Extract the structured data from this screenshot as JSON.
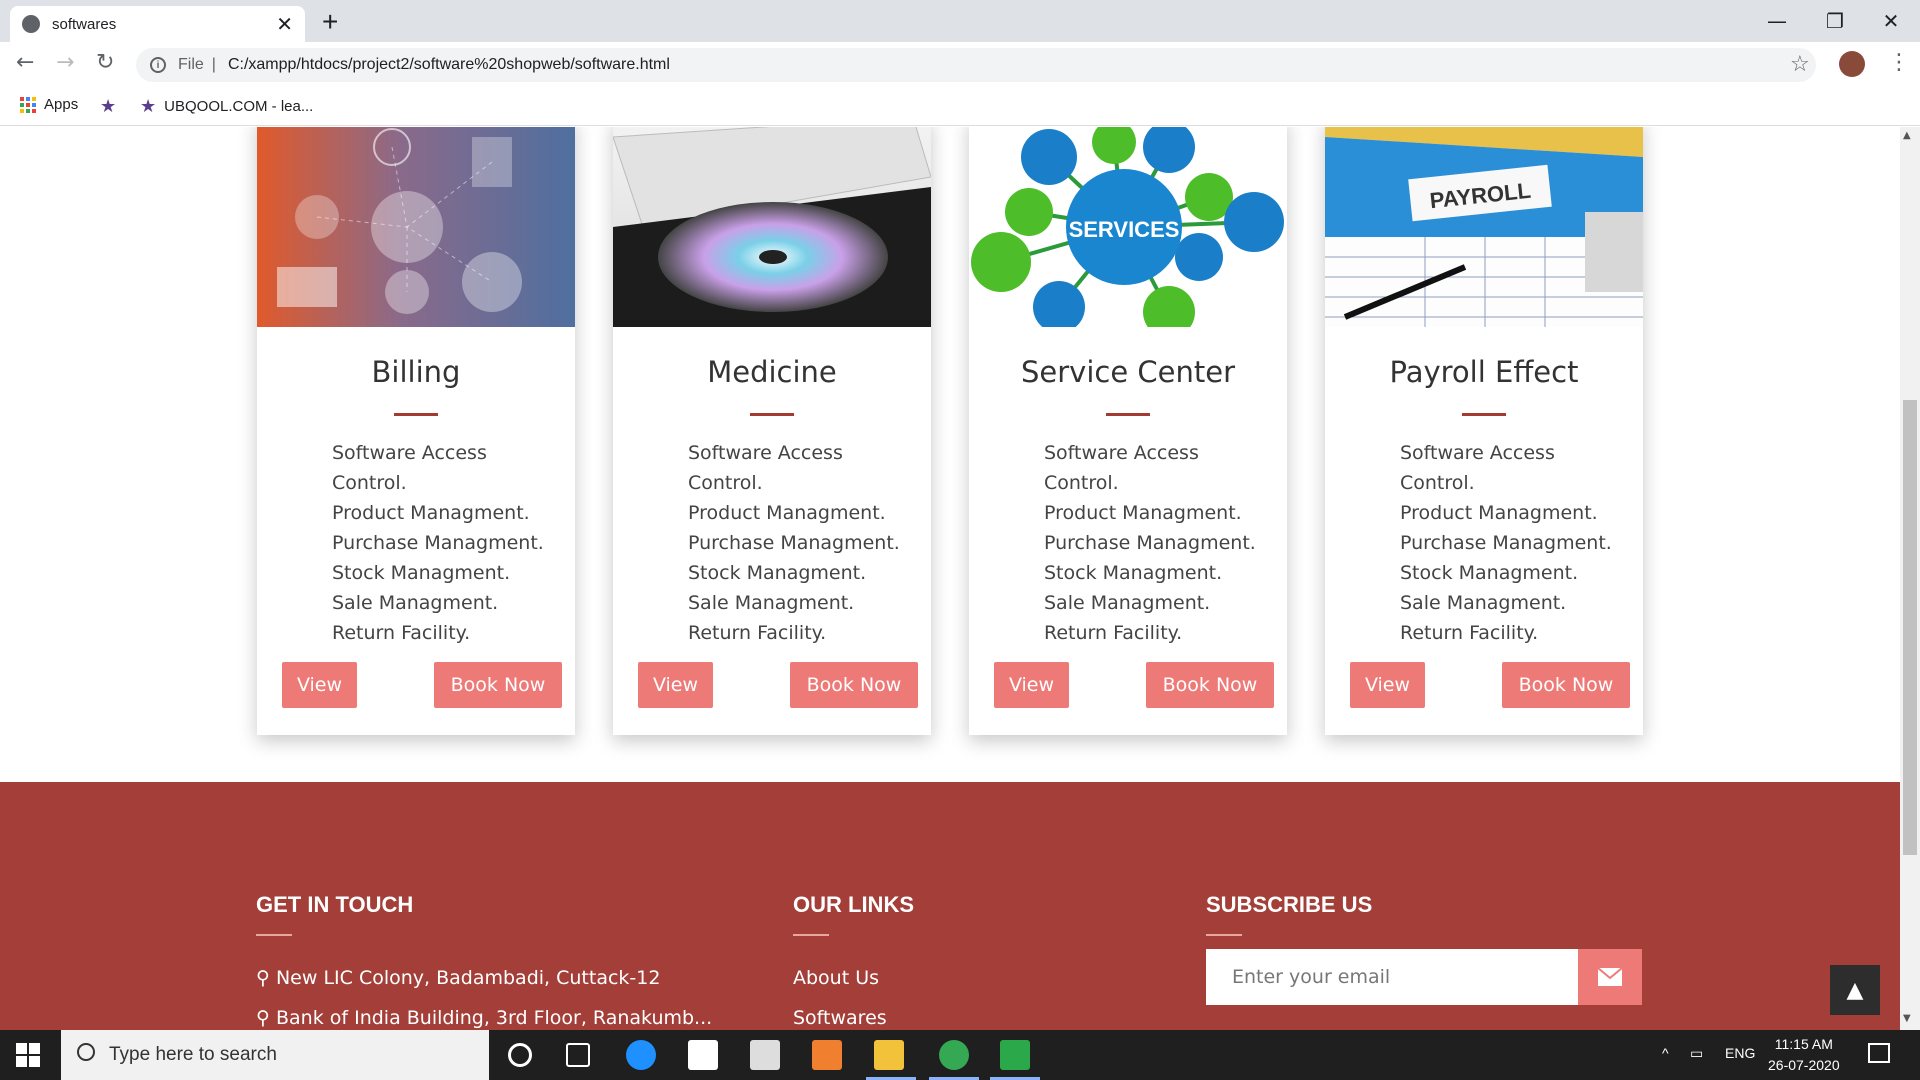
{
  "browser": {
    "tab_title": "softwares",
    "url_scheme": "File",
    "url": "C:/xampp/htdocs/project2/software%20shopweb/software.html",
    "bookmarks": [
      {
        "label": "Apps",
        "icon": "apps-grid-icon"
      },
      {
        "label": "",
        "icon": "bookmark-star-icon"
      },
      {
        "label": "UBQOOL.COM - lea...",
        "icon": "bookmark-star-icon"
      }
    ]
  },
  "cards": [
    {
      "title": "Billing",
      "image": "billing-illustration",
      "features": [
        "Software Access",
        "Control.",
        "Product Managment.",
        "Purchase Managment.",
        "Stock Managment.",
        "Sale Managment.",
        "Return Facility."
      ],
      "view_label": "View",
      "book_label": "Book Now"
    },
    {
      "title": "Medicine",
      "image": "laptop-cd-drive-photo",
      "features": [
        "Software Access",
        "Control.",
        "Product Managment.",
        "Purchase Managment.",
        "Stock Managment.",
        "Sale Managment.",
        "Return Facility."
      ],
      "view_label": "View",
      "book_label": "Book Now"
    },
    {
      "title": "Service Center",
      "image": "services-network-diagram",
      "image_text": "SERVICES",
      "features": [
        "Software Access",
        "Control.",
        "Product Managment.",
        "Purchase Managment.",
        "Stock Managment.",
        "Sale Managment.",
        "Return Facility."
      ],
      "view_label": "View",
      "book_label": "Book Now"
    },
    {
      "title": "Payroll Effect",
      "image": "payroll-binder-photo",
      "image_text": "PAYROLL",
      "features": [
        "Software Access",
        "Control.",
        "Product Managment.",
        "Purchase Managment.",
        "Stock Managment.",
        "Sale Managment.",
        "Return Facility."
      ],
      "view_label": "View",
      "book_label": "Book Now"
    }
  ],
  "footer": {
    "contact_heading": "GET IN TOUCH",
    "address": "New LIC Colony, Badambadi, Cuttack-12",
    "address2": "Bank of India Building, 3rd Floor, Ranakumb...",
    "links_heading": "OUR LINKS",
    "links": [
      "About Us",
      "Softwares"
    ],
    "subscribe_heading": "SUBSCRIBE US",
    "email_placeholder": "Enter your email"
  },
  "taskbar": {
    "search_placeholder": "Type here to search",
    "language": "ENG",
    "time": "11:15 AM",
    "date": "26-07-2020"
  },
  "colors": {
    "accent": "#ee7a78",
    "footer_bg": "#a33f38",
    "rule": "#a33b32"
  }
}
